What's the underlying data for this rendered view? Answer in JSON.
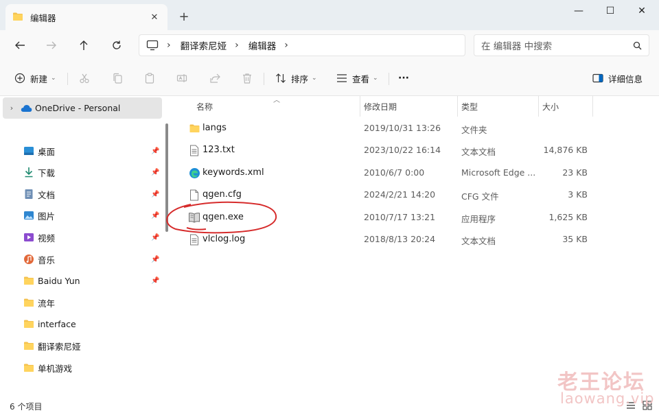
{
  "tab": {
    "title": "编辑器",
    "new_tab": "+"
  },
  "window_controls": {
    "minimize": "—",
    "maximize": "☐",
    "close": "✕"
  },
  "breadcrumb": [
    "翻译索尼娅",
    "编辑器"
  ],
  "search": {
    "placeholder": "在 编辑器 中搜索"
  },
  "toolbar": {
    "new_label": "新建",
    "sort_label": "排序",
    "view_label": "查看",
    "more_label": "···",
    "details_label": "详细信息"
  },
  "sidebar": {
    "onedrive": "OneDrive - Personal",
    "items": [
      {
        "label": "桌面",
        "icon": "desktop-icon",
        "pinned": true
      },
      {
        "label": "下载",
        "icon": "download-icon",
        "pinned": true
      },
      {
        "label": "文档",
        "icon": "document-icon",
        "pinned": true
      },
      {
        "label": "图片",
        "icon": "picture-icon",
        "pinned": true
      },
      {
        "label": "视频",
        "icon": "video-icon",
        "pinned": true
      },
      {
        "label": "音乐",
        "icon": "music-icon",
        "pinned": true
      },
      {
        "label": "Baidu Yun",
        "icon": "folder-icon",
        "pinned": true
      },
      {
        "label": "流年",
        "icon": "folder-icon",
        "pinned": false
      },
      {
        "label": "interface",
        "icon": "folder-icon",
        "pinned": false
      },
      {
        "label": "翻译索尼娅",
        "icon": "folder-icon",
        "pinned": false
      },
      {
        "label": "单机游戏",
        "icon": "folder-icon",
        "pinned": false
      }
    ]
  },
  "columns": {
    "name": "名称",
    "date": "修改日期",
    "type": "类型",
    "size": "大小"
  },
  "files": [
    {
      "name": "langs",
      "date": "2019/10/31 13:26",
      "type": "文件夹",
      "size": "",
      "icon": "folder-icon"
    },
    {
      "name": "123.txt",
      "date": "2023/10/22 16:14",
      "type": "文本文档",
      "size": "14,876 KB",
      "icon": "text-file-icon"
    },
    {
      "name": "keywords.xml",
      "date": "2010/6/7 0:00",
      "type": "Microsoft Edge ...",
      "size": "23 KB",
      "icon": "edge-icon"
    },
    {
      "name": "qgen.cfg",
      "date": "2024/2/21 14:20",
      "type": "CFG 文件",
      "size": "3 KB",
      "icon": "file-icon"
    },
    {
      "name": "qgen.exe",
      "date": "2010/7/17 13:21",
      "type": "应用程序",
      "size": "1,625 KB",
      "icon": "exe-book-icon"
    },
    {
      "name": "vlclog.log",
      "date": "2018/8/13 20:24",
      "type": "文本文档",
      "size": "35 KB",
      "icon": "text-file-icon"
    }
  ],
  "status": {
    "item_count": "6 个项目"
  },
  "watermark": {
    "line1": "老王论坛",
    "line2": "laowang.vip"
  },
  "colors": {
    "folder": "#f4c24f",
    "accent": "#0067c0",
    "annotation": "#d62b2b",
    "watermark": "#f2c5c5"
  }
}
